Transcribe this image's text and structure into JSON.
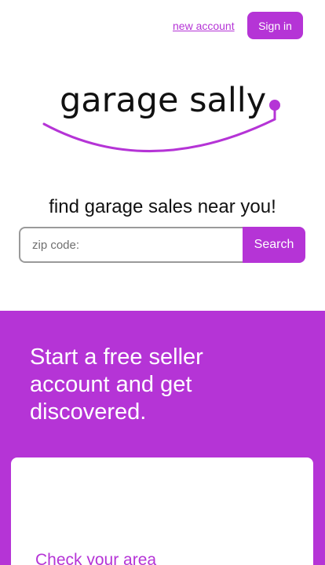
{
  "header": {
    "new_account_label": "new account",
    "sign_in_label": "Sign in"
  },
  "logo": {
    "text": "garage sally"
  },
  "search": {
    "tagline": "find garage sales near you!",
    "placeholder": "zip code:",
    "value": "",
    "button_label": "Search"
  },
  "promo": {
    "heading": "Start a free seller account and get discovered.",
    "card_link_label": "Check your area"
  },
  "colors": {
    "accent": "#b534d6",
    "background": "#ffffff",
    "text": "#111111"
  }
}
